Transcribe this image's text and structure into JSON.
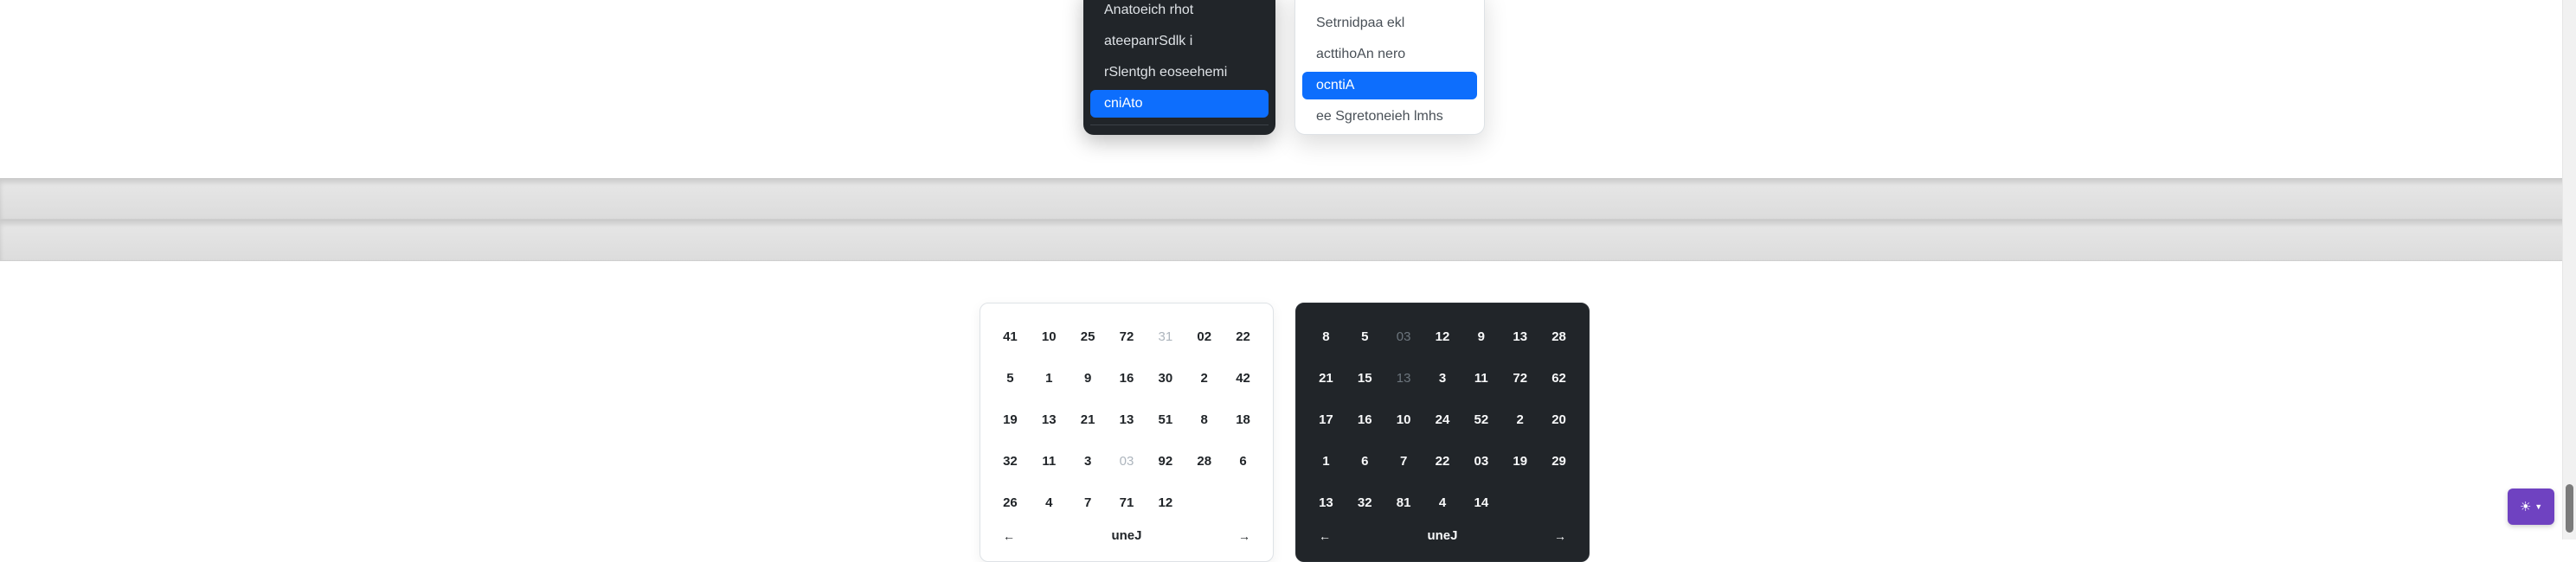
{
  "dark_menu": {
    "items": [
      "Anatoeich rhot",
      "ateepanrSdlk i",
      "rSlentgh eoseehemi",
      "cniAto"
    ],
    "active_index": 3
  },
  "light_menu": {
    "items": [
      "Setrnidpaa ekl",
      "acttihoAn nero",
      "ocntiA",
      "ee Sgretoneieh lmhs"
    ],
    "active_index": 2
  },
  "calendar_light": {
    "days": [
      "41",
      "10",
      "25",
      "72",
      "31",
      "02",
      "22",
      "5",
      "1",
      "9",
      "16",
      "30",
      "2",
      "42",
      "19",
      "13",
      "21",
      "13",
      "51",
      "8",
      "18",
      "32",
      "11",
      "3",
      "03",
      "92",
      "28",
      "6",
      "26",
      "4",
      "7",
      "71",
      "12",
      "",
      ""
    ],
    "muted": [
      4,
      24
    ],
    "footer_label": "uneJ",
    "prev_icon": "arrow-left-icon",
    "next_icon": "arrow-right-icon"
  },
  "calendar_dark": {
    "days": [
      "8",
      "5",
      "03",
      "12",
      "9",
      "13",
      "28",
      "21",
      "15",
      "13",
      "3",
      "11",
      "72",
      "62",
      "17",
      "16",
      "10",
      "24",
      "52",
      "2",
      "20",
      "1",
      "6",
      "7",
      "22",
      "03",
      "19",
      "29",
      "13",
      "32",
      "81",
      "4",
      "14",
      "",
      ""
    ],
    "muted": [
      2,
      9
    ],
    "footer_label": "uneJ",
    "prev_icon": "arrow-left-icon",
    "next_icon": "arrow-right-icon"
  },
  "theme_toggle": {
    "icon": "sun-icon",
    "caret_icon": "caret-down-icon",
    "color": "#6f42c1"
  },
  "colors": {
    "accent": "#0d6efd",
    "dark_bg": "#212529",
    "toggle": "#6f42c1"
  }
}
